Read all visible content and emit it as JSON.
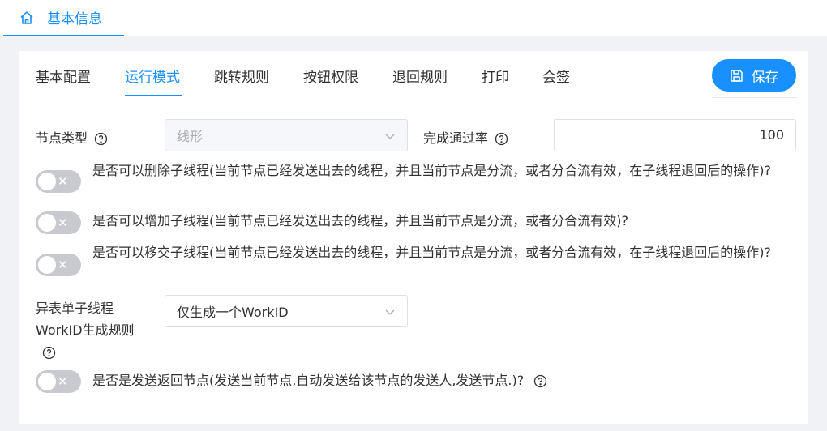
{
  "page_tab": {
    "label": "基本信息",
    "icon": "home-icon"
  },
  "tabs": [
    {
      "label": "基本配置"
    },
    {
      "label": "运行模式"
    },
    {
      "label": "跳转规则"
    },
    {
      "label": "按钮权限"
    },
    {
      "label": "退回规则"
    },
    {
      "label": "打印"
    },
    {
      "label": "会签"
    }
  ],
  "active_tab": "运行模式",
  "save_button": {
    "label": "保存",
    "icon": "save-icon"
  },
  "form": {
    "node_type": {
      "label": "节点类型",
      "value": "线形",
      "disabled": true
    },
    "pass_rate": {
      "label": "完成通过率",
      "value": "100"
    },
    "switches": [
      {
        "label": "是否可以删除子线程(当前节点已经发送出去的线程，并且当前节点是分流，或者分合流有效，在子线程退回后的操作)?",
        "on": false
      },
      {
        "label": "是否可以增加子线程(当前节点已经发送出去的线程，并且当前节点是分流，或者分合流有效)?",
        "on": false
      },
      {
        "label": "是否可以移交子线程(当前节点已经发送出去的线程，并且当前节点是分流，或者分合流有效，在子线程退回后的操作)?",
        "on": false
      }
    ],
    "workid_rule": {
      "label": "异表单子线程WorkID生成规则",
      "value": "仅生成一个WorkID"
    },
    "return_node": {
      "label": "是否是发送返回节点(发送当前节点,自动发送给该节点的发送人,发送节点.)?",
      "on": false
    }
  },
  "colors": {
    "accent": "#1890ff",
    "switch_off": "#c8cacf"
  }
}
